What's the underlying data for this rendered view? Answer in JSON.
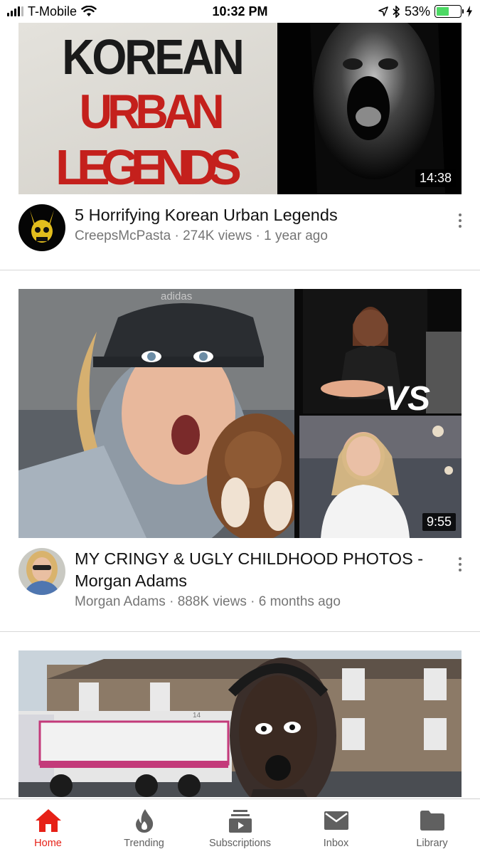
{
  "status_bar": {
    "carrier": "T-Mobile",
    "time": "10:32 PM",
    "battery_percent": "53%",
    "battery_level": 0.53
  },
  "videos": [
    {
      "thumbnail_text": [
        "KOREAN",
        "URBAN",
        "LEGENDS"
      ],
      "duration": "14:38",
      "title": "5 Horrifying Korean Urban Legends",
      "channel": "CreepsMcPasta",
      "views": "274K views",
      "age": "1 year ago"
    },
    {
      "thumbnail_text": [
        "adidas",
        "VS"
      ],
      "duration": "9:55",
      "title": "MY CRINGY & UGLY CHILDHOOD PHOTOS - Morgan Adams",
      "channel": "Morgan Adams",
      "views": "888K views",
      "age": "6 months ago"
    },
    {
      "thumbnail_text": [
        "14"
      ]
    }
  ],
  "separator": " · ",
  "bottom_nav": [
    {
      "label": "Home",
      "icon": "home-icon",
      "active": true
    },
    {
      "label": "Trending",
      "icon": "flame-icon",
      "active": false
    },
    {
      "label": "Subscriptions",
      "icon": "subscriptions-icon",
      "active": false
    },
    {
      "label": "Inbox",
      "icon": "mail-icon",
      "active": false
    },
    {
      "label": "Library",
      "icon": "folder-icon",
      "active": false
    }
  ],
  "colors": {
    "accent_red": "#e62117",
    "inactive_gray": "#606060",
    "battery_green": "#4cd964"
  }
}
